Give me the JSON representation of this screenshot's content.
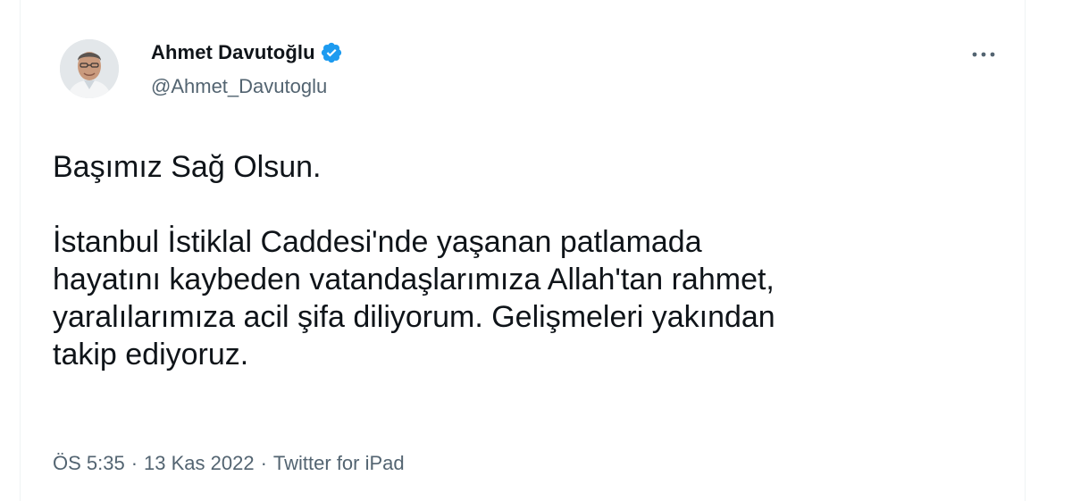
{
  "author": {
    "display_name": "Ahmet Davutoğlu",
    "handle": "@Ahmet_Davutoglu",
    "verified_icon": "verified-badge-icon"
  },
  "menu": {
    "more_icon": "more-horizontal-icon"
  },
  "tweet": {
    "text": "Başımız Sağ Olsun.\n\nİstanbul İstiklal Caddesi'nde yaşanan patlamada\nhayatını kaybeden vatandaşlarımıza Allah'tan rahmet,\nyaralılarımıza acil şifa diliyorum. Gelişmeleri yakından\ntakip ediyoruz.",
    "time": "ÖS 5:35",
    "date": "13 Kas 2022",
    "source": "Twitter for iPad",
    "separator": "·"
  },
  "colors": {
    "verified": "#1d9bf0",
    "text": "#0f1419",
    "secondary": "#536471"
  }
}
